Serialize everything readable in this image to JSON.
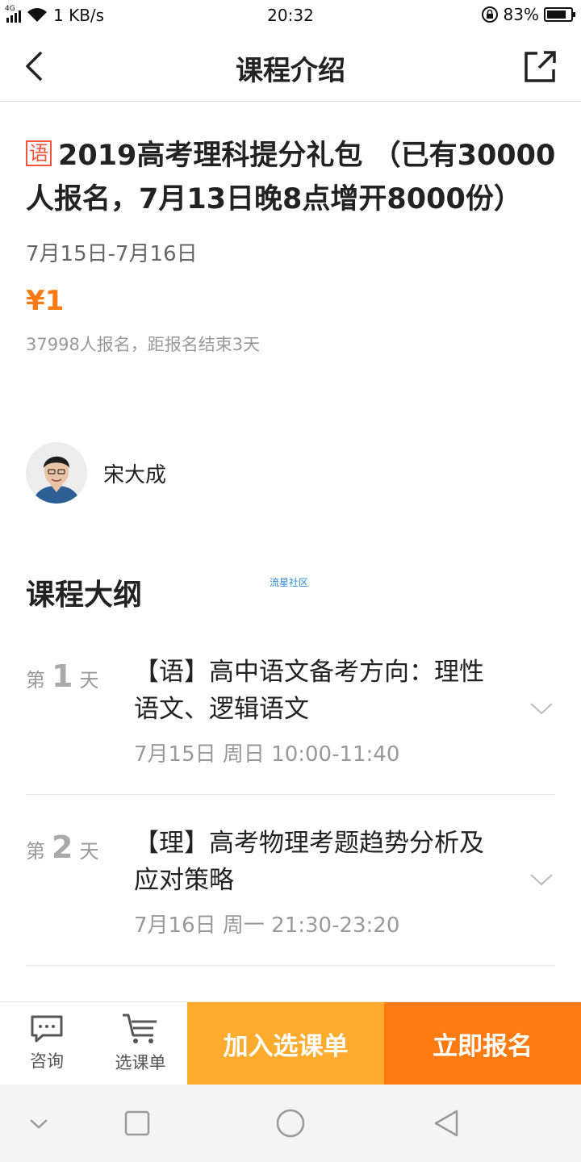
{
  "status_bar": {
    "network": "4G",
    "speed": "1 KB/s",
    "time": "20:32",
    "battery_percent": "83%",
    "battery_level": 0.83
  },
  "nav": {
    "title": "课程介绍"
  },
  "course": {
    "subject_tag": "语",
    "title": "2019高考理科提分礼包 （已有30000人报名，7月13日晚8点增开8000份）",
    "date_range": "7月15日-7月16日",
    "price": "¥1",
    "signup_info": "37998人报名，距报名结束3天"
  },
  "teacher": {
    "name": "宋大成"
  },
  "outline": {
    "heading": "课程大纲",
    "watermark": "流星社区",
    "lessons": [
      {
        "day_prefix": "第",
        "day_num": "1",
        "day_suffix": "天",
        "title": "【语】高中语文备考方向：理性语文、逻辑语文",
        "time": "7月15日 周日 10:00-11:40"
      },
      {
        "day_prefix": "第",
        "day_num": "2",
        "day_suffix": "天",
        "title": "【理】高考物理考题趋势分析及应对策略",
        "time": "7月16日 周一 21:30-23:20"
      }
    ]
  },
  "actions": {
    "consult_label": "咨询",
    "cart_label": "选课单",
    "add_to_cart": "加入选课单",
    "signup_now": "立即报名"
  },
  "colors": {
    "accent_orange": "#ff7a10",
    "accent_yellow": "#ffab2e",
    "tag_red": "#f2553c"
  }
}
